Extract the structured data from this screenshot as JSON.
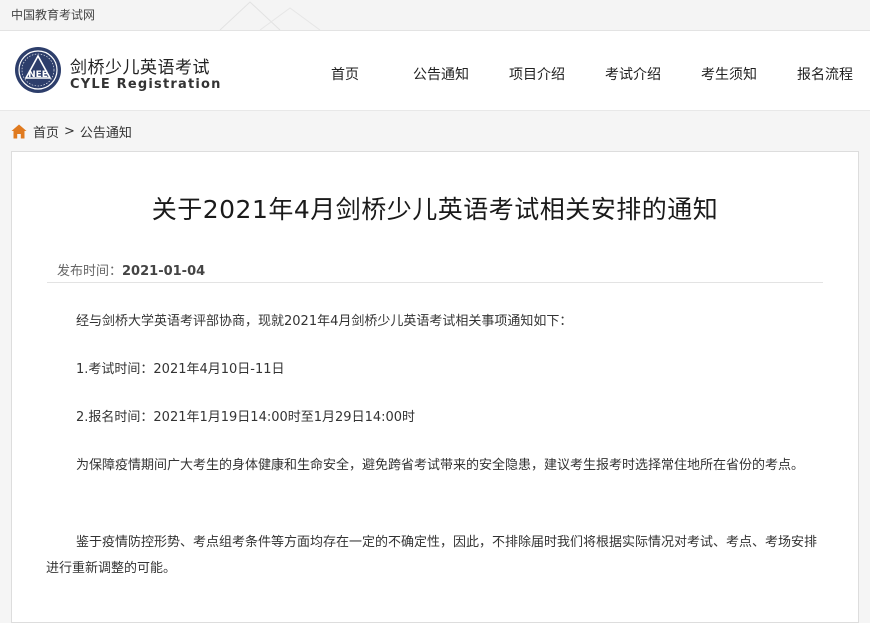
{
  "topbar": {
    "site_link": "中国教育考试网"
  },
  "header": {
    "logo_text": "NEE",
    "brand_cn": "剑桥少儿英语考试",
    "brand_en": "CYLE Registration",
    "nav": [
      {
        "label": "首页"
      },
      {
        "label": "公告通知"
      },
      {
        "label": "项目介绍"
      },
      {
        "label": "考试介绍"
      },
      {
        "label": "考生须知"
      },
      {
        "label": "报名流程"
      }
    ]
  },
  "breadcrumb": {
    "home": "首页",
    "separator": ">",
    "current": "公告通知"
  },
  "article": {
    "title": "关于2021年4月剑桥少儿英语考试相关安排的通知",
    "meta_label": "发布时间：",
    "meta_date": "2021-01-04",
    "paragraphs": [
      "经与剑桥大学英语考评部协商，现就2021年4月剑桥少儿英语考试相关事项通知如下：",
      "1.考试时间：2021年4月10日-11日",
      "2.报名时间：2021年1月19日14:00时至1月29日14:00时",
      "为保障疫情期间广大考生的身体健康和生命安全，避免跨省考试带来的安全隐患，建议考生报考时选择常住地所在省份的考点。",
      "鉴于疫情防控形势、考点组考条件等方面均存在一定的不确定性，因此，不排除届时我们将根据实际情况对考试、考点、考场安排进行重新调整的可能。"
    ]
  },
  "colors": {
    "home_icon": "#e07a1f",
    "logo": "#2d3e6b"
  }
}
